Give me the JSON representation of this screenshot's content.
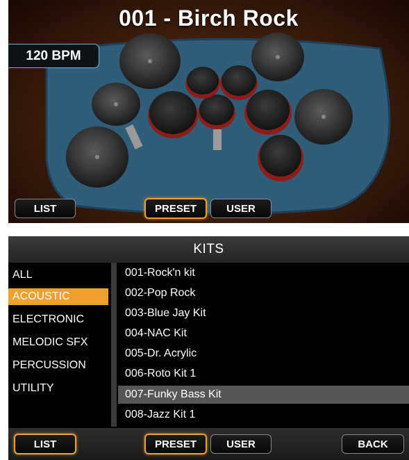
{
  "top_screen": {
    "kit_title": "001 - Birch Rock",
    "bpm": "120 BPM",
    "buttons": {
      "list": "LIST",
      "preset": "PRESET",
      "user": "USER"
    },
    "active_button": "preset"
  },
  "kits_panel": {
    "header": "KITS",
    "categories": [
      "ALL",
      "ACOUSTIC",
      "ELECTRONIC",
      "MELODIC SFX",
      "PERCUSSION",
      "UTILITY"
    ],
    "selected_category": "ACOUSTIC",
    "kits": [
      "001-Rock'n kit",
      "002-Pop Rock",
      "003-Blue Jay Kit",
      "004-NAC Kit",
      "005-Dr. Acrylic",
      "006-Roto Kit 1",
      "007-Funky Bass Kit",
      "008-Jazz Kit 1"
    ],
    "selected_kit": "007-Funky Bass Kit",
    "buttons": {
      "list": "LIST",
      "preset": "PRESET",
      "user": "USER",
      "back": "BACK"
    }
  },
  "colors": {
    "accent_orange": "#f0a02e",
    "bpm_border": "#69b7da",
    "rug_blue": "#2f5d7a",
    "drum_red": "#8e1d18"
  }
}
